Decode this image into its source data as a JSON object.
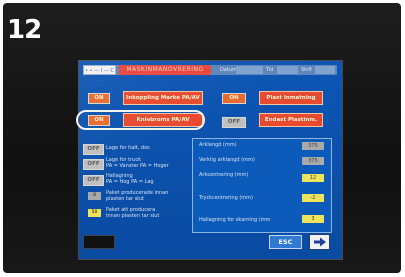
{
  "photo": {
    "number": "12"
  },
  "header": {
    "logo_text": "• • — I — C —",
    "title": "MASKINMANOVRERING",
    "date_label": "Datum",
    "time_label": "Tid",
    "user_label": "Skift"
  },
  "buttons": {
    "row1_state": "ON",
    "row1_label": "Inkoppling Marke PA/AV",
    "row1_right_state": "ON",
    "row1_right_label": "Plast Inmatning",
    "row2_state": "ON",
    "row2_label": "Knivbroms PA/AV",
    "row2_right_state": "OFF",
    "row2_right_label": "Endast Plastinm."
  },
  "options": [
    {
      "state": "OFF",
      "label": "Lage for halt, dos"
    },
    {
      "state": "OFF",
      "label": "Lage for truck\nPA = Vanster  PA = Hoger"
    },
    {
      "state": "OFF",
      "label": "Hallagning\nPA = Hog  PA = Lag"
    },
    {
      "state": "0",
      "label": "Paket producerade innan\nplasten tar slut"
    },
    {
      "state": "50",
      "label": "Paket att producera\ninnan plasten tar slut"
    }
  ],
  "panel": {
    "rows": [
      {
        "label": "Arklangd (mm)",
        "value": "375",
        "style": "gray"
      },
      {
        "label": "Verklig arklangd (mm)",
        "value": "375",
        "style": "gray"
      },
      {
        "label": "Arkcentrering  (mm)",
        "value": "12",
        "style": "yellow"
      },
      {
        "label": "Tryckcentrering (mm)",
        "value": "-2",
        "style": "yellow"
      },
      {
        "label": "Hallagning for skarning (mm",
        "value": "3",
        "style": "yellow"
      }
    ]
  },
  "footer": {
    "esc_label": "ESC",
    "next_icon": "arrow-right-icon"
  },
  "colors": {
    "screen_blue": "#0d56b4",
    "on_orange": "#e86a2c",
    "func_red": "#e84a2f",
    "off_gray": "#bfbfbf",
    "value_yellow": "#f0e35c"
  }
}
